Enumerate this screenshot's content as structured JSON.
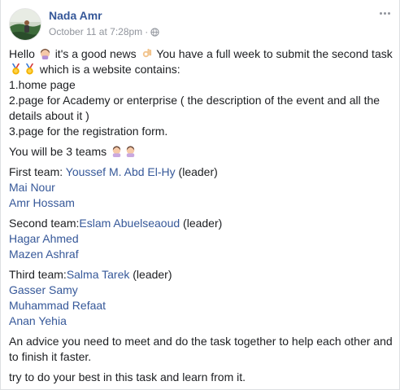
{
  "post": {
    "author": "Nada Amr",
    "timestamp": "October 11 at 7:28pm",
    "privacy_icon": "globe-icon",
    "more_icon": "more-options-icon",
    "body": {
      "intro": {
        "p1": "Hello",
        "p2": "it's a good news",
        "p3": "You have a full week to submit the second task",
        "p4": "which is a website contains:"
      },
      "items": [
        "1.home page",
        "2.page for Academy or enterprise ( the description of the event and all the details about it )",
        "3.page for the registration form."
      ],
      "teams_intro": "You will be 3 teams",
      "teams": [
        {
          "label": "First team: ",
          "leader": "Youssef M. Abd El-Hy",
          "leader_suffix": " (leader)",
          "members": [
            "Mai Nour",
            "Amr Hossam"
          ]
        },
        {
          "label": "Second team:",
          "leader": "Eslam Abuelseaoud",
          "leader_suffix": " (leader)",
          "members": [
            "Hagar Ahmed",
            "Mazen Ashraf"
          ]
        },
        {
          "label": "Third team:",
          "leader": "Salma Tarek",
          "leader_suffix": " (leader)",
          "members": [
            "Gasser Samy",
            "Muhammad Refaat",
            "Anan Yehia"
          ]
        }
      ],
      "advice": "An advice you need to meet and do the task together to help each other and to finish it faster.",
      "closing": "try to do your best in this task and learn from it."
    }
  },
  "colors": {
    "link": "#365899",
    "text": "#1c1e21",
    "meta": "#90949c"
  }
}
